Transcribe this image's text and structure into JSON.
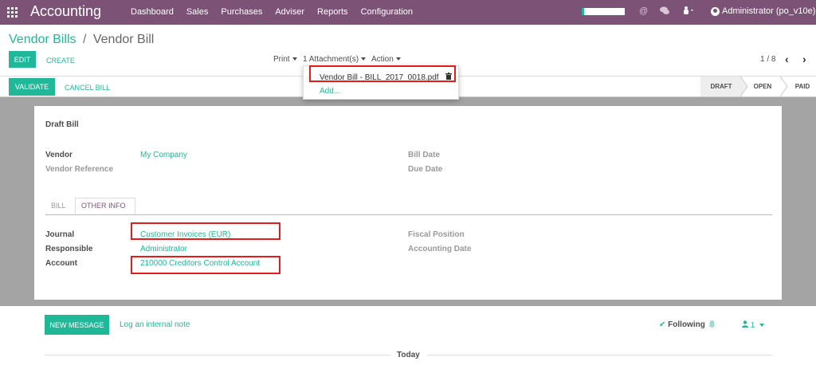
{
  "navbar": {
    "app_title": "Accounting",
    "menu": [
      "Dashboard",
      "Sales",
      "Purchases",
      "Adviser",
      "Reports",
      "Configuration"
    ],
    "user": "Administrator (po_v10e)",
    "icons": [
      "apps-grid-icon",
      "at-icon",
      "chat-icon",
      "bug-icon"
    ]
  },
  "breadcrumb": {
    "parent": "Vendor Bills",
    "separator": "/",
    "current": "Vendor Bill"
  },
  "buttons": {
    "edit": "EDIT",
    "create": "CREATE",
    "validate": "VALIDATE",
    "cancel_bill": "CANCEL BILL"
  },
  "sidebar": {
    "print": "Print",
    "attachments": "1 Attachment(s)",
    "action": "Action"
  },
  "pager": {
    "value": "1 / 8",
    "prev": "‹",
    "next": "›"
  },
  "attachment_dropdown": {
    "file": "Vendor Bill - BILL_2017_0018.pdf",
    "add": "Add..."
  },
  "statusbar": {
    "stages": [
      "DRAFT",
      "OPEN",
      "PAID"
    ],
    "active": "DRAFT"
  },
  "sheet": {
    "title": "Draft Bill",
    "vendor_label": "Vendor",
    "vendor_value": "My Company",
    "vendor_ref_label": "Vendor Reference",
    "bill_date_label": "Bill Date",
    "due_date_label": "Due Date",
    "tabs": [
      "BILL",
      "OTHER INFO"
    ],
    "active_tab": "OTHER INFO",
    "journal_label": "Journal",
    "journal_value": "Customer Invoices (EUR)",
    "responsible_label": "Responsible",
    "responsible_value": "Administrator",
    "account_label": "Account",
    "account_value": "210000 Creditors Control Account",
    "fiscal_position_label": "Fiscal Position",
    "accounting_date_label": "Accounting Date"
  },
  "chatter": {
    "new_message": "NEW MESSAGE",
    "log_note": "Log an internal note",
    "following": "Following",
    "followers_count": "1",
    "today": "Today"
  },
  "colors": {
    "navbar": "#7c5276",
    "accent": "#21b799",
    "highlight": "#e41c1c"
  }
}
